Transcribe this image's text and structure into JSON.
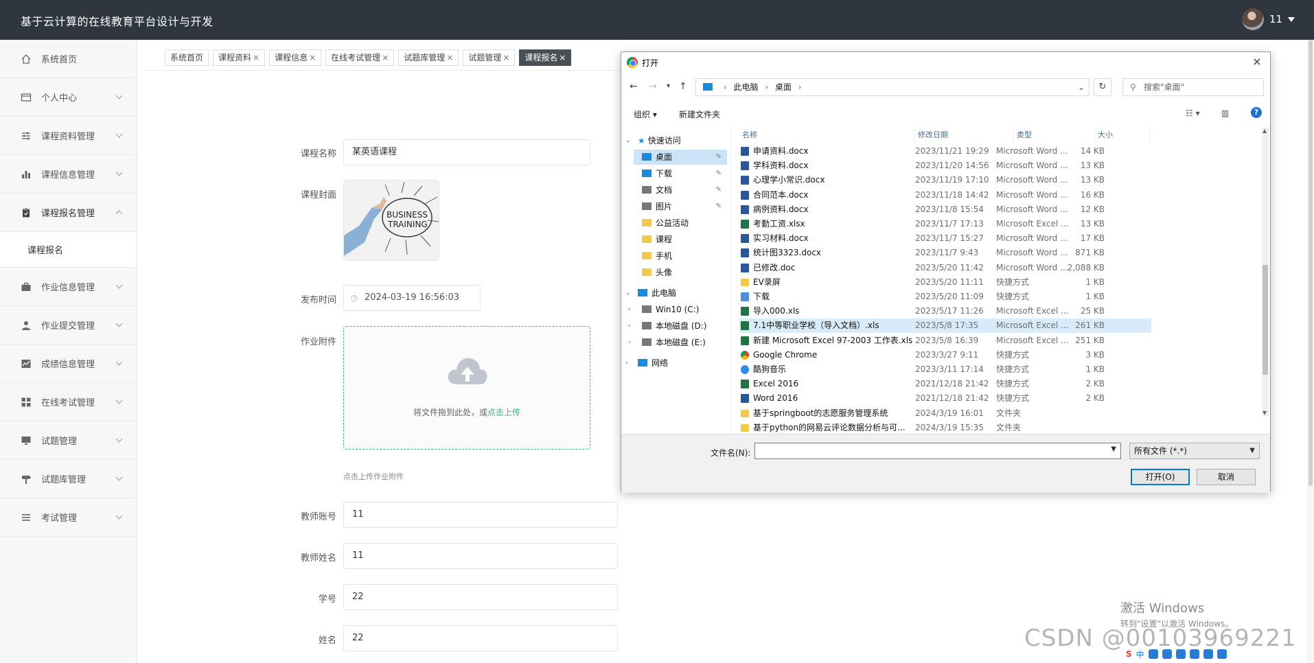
{
  "header": {
    "title": "基于云计算的在线教育平台设计与开发",
    "user": "11"
  },
  "sidebar": {
    "items": [
      {
        "label": "系统首页",
        "icon": "home-icon"
      },
      {
        "label": "个人中心",
        "icon": "id-card-icon"
      },
      {
        "label": "课程资料管理",
        "icon": "sliders-icon"
      },
      {
        "label": "课程信息管理",
        "icon": "bar-chart-icon"
      },
      {
        "label": "课程报名管理",
        "icon": "clipboard-icon",
        "open": true,
        "sub": [
          "课程报名"
        ]
      },
      {
        "label": "作业信息管理",
        "icon": "briefcase-icon"
      },
      {
        "label": "作业提交管理",
        "icon": "user-icon"
      },
      {
        "label": "成绩信息管理",
        "icon": "chart-line-icon"
      },
      {
        "label": "在线考试管理",
        "icon": "grid-icon"
      },
      {
        "label": "试题管理",
        "icon": "monitor-icon"
      },
      {
        "label": "试题库管理",
        "icon": "signpost-icon"
      },
      {
        "label": "考试管理",
        "icon": "list-icon"
      }
    ]
  },
  "tabs": [
    {
      "label": "系统首页",
      "closable": false
    },
    {
      "label": "课程资料",
      "closable": true
    },
    {
      "label": "课程信息",
      "closable": true
    },
    {
      "label": "在线考试管理",
      "closable": true
    },
    {
      "label": "试题库管理",
      "closable": true
    },
    {
      "label": "试题管理",
      "closable": true
    },
    {
      "label": "课程报名",
      "closable": true,
      "active": true
    }
  ],
  "tab_close": "×",
  "form": {
    "course_name_label": "课程名称",
    "course_name_value": "某英语课程",
    "cover_label": "课程封面",
    "cover_text_1": "BUSINESS",
    "cover_text_2": "TRAINING",
    "publish_time_label": "发布时间",
    "publish_time_value": "2024-03-19 16:56:03",
    "attachment_label": "作业附件",
    "upload_text": "将文件拖到此处，或",
    "upload_link": "点击上传",
    "upload_hint": "点击上传作业附件",
    "teacher_account_label": "教师账号",
    "teacher_account_value": "11",
    "teacher_name_label": "教师姓名",
    "teacher_name_value": "11",
    "student_id_label": "学号",
    "student_id_value": "22",
    "name_label": "姓名",
    "name_value": "22"
  },
  "dialog": {
    "title": "打开",
    "close": "×",
    "breadcrumb": [
      "此电脑",
      "桌面"
    ],
    "search_placeholder": "搜索\"桌面\"",
    "toolbar_organize": "组织 ▾",
    "toolbar_new_folder": "新建文件夹",
    "help": "?",
    "nav": [
      {
        "label": "快速访问",
        "level": 0,
        "kind": "star"
      },
      {
        "label": "桌面",
        "level": 1,
        "kind": "blue",
        "pinned": true,
        "selected": true
      },
      {
        "label": "下载",
        "level": 1,
        "kind": "blue",
        "pinned": true
      },
      {
        "label": "文档",
        "level": 1,
        "kind": "gray",
        "pinned": true
      },
      {
        "label": "图片",
        "level": 1,
        "kind": "gray",
        "pinned": true
      },
      {
        "label": "公益活动",
        "level": 1,
        "kind": "yellow"
      },
      {
        "label": "课程",
        "level": 1,
        "kind": "yellow"
      },
      {
        "label": "手机",
        "level": 1,
        "kind": "yellow"
      },
      {
        "label": "头像",
        "level": 1,
        "kind": "yellow"
      },
      {
        "label": "此电脑",
        "level": 0,
        "kind": "blue"
      },
      {
        "label": "Win10 (C:)",
        "level": 1,
        "kind": "gray"
      },
      {
        "label": "本地磁盘 (D:)",
        "level": 1,
        "kind": "gray"
      },
      {
        "label": "本地磁盘 (E:)",
        "level": 1,
        "kind": "gray"
      },
      {
        "label": "网络",
        "level": 0,
        "kind": "blue"
      }
    ],
    "columns": {
      "name": "名称",
      "date": "修改日期",
      "type": "类型",
      "size": "大小"
    },
    "files": [
      {
        "name": "申请资料.docx",
        "date": "2023/11/21 19:29",
        "type": "Microsoft Word ...",
        "size": "14 KB",
        "kind": "word"
      },
      {
        "name": "学科资料.docx",
        "date": "2023/11/20 14:56",
        "type": "Microsoft Word ...",
        "size": "13 KB",
        "kind": "word"
      },
      {
        "name": "心理学小常识.docx",
        "date": "2023/11/19 17:10",
        "type": "Microsoft Word ...",
        "size": "13 KB",
        "kind": "word"
      },
      {
        "name": "合同范本.docx",
        "date": "2023/11/18 14:42",
        "type": "Microsoft Word ...",
        "size": "16 KB",
        "kind": "word"
      },
      {
        "name": "病例资料.docx",
        "date": "2023/11/8 15:54",
        "type": "Microsoft Word ...",
        "size": "12 KB",
        "kind": "word"
      },
      {
        "name": "考勤工资.xlsx",
        "date": "2023/11/7 17:13",
        "type": "Microsoft Excel ...",
        "size": "13 KB",
        "kind": "excel"
      },
      {
        "name": "实习材料.docx",
        "date": "2023/11/7 15:27",
        "type": "Microsoft Word ...",
        "size": "17 KB",
        "kind": "word"
      },
      {
        "name": "统计图3323.docx",
        "date": "2023/11/7 9:43",
        "type": "Microsoft Word ...",
        "size": "871 KB",
        "kind": "word"
      },
      {
        "name": "已修改.doc",
        "date": "2023/5/20 11:42",
        "type": "Microsoft Word ...",
        "size": "2,088 KB",
        "kind": "word"
      },
      {
        "name": "EV录屏",
        "date": "2023/5/20 11:11",
        "type": "快捷方式",
        "size": "1 KB",
        "kind": "folder"
      },
      {
        "name": "下载",
        "date": "2023/5/20 11:09",
        "type": "快捷方式",
        "size": "1 KB",
        "kind": "lnk"
      },
      {
        "name": "导入000.xls",
        "date": "2023/5/17 11:26",
        "type": "Microsoft Excel ...",
        "size": "25 KB",
        "kind": "excel"
      },
      {
        "name": "7.1中等职业学校（导入文档）.xls",
        "date": "2023/5/8 17:35",
        "type": "Microsoft Excel ...",
        "size": "261 KB",
        "kind": "excel",
        "selected": true
      },
      {
        "name": "新建 Microsoft Excel 97-2003 工作表.xls",
        "date": "2023/5/8 16:39",
        "type": "Microsoft Excel ...",
        "size": "251 KB",
        "kind": "excel"
      },
      {
        "name": "Google Chrome",
        "date": "2023/3/27 9:11",
        "type": "快捷方式",
        "size": "3 KB",
        "kind": "chrome"
      },
      {
        "name": "酷狗音乐",
        "date": "2023/3/11 17:14",
        "type": "快捷方式",
        "size": "1 KB",
        "kind": "music"
      },
      {
        "name": "Excel 2016",
        "date": "2021/12/18 21:42",
        "type": "快捷方式",
        "size": "2 KB",
        "kind": "excel"
      },
      {
        "name": "Word 2016",
        "date": "2021/12/18 21:42",
        "type": "快捷方式",
        "size": "2 KB",
        "kind": "word"
      },
      {
        "name": "基于springboot的志愿服务管理系统",
        "date": "2024/3/19 16:01",
        "type": "文件夹",
        "size": "",
        "kind": "folder"
      },
      {
        "name": "基于python的网易云评论数据分析与可...",
        "date": "2024/3/19 15:35",
        "type": "文件夹",
        "size": "",
        "kind": "folder"
      }
    ],
    "filename_label": "文件名(N):",
    "filename_value": "",
    "filetype": "所有文件 (*.*)",
    "open_btn": "打开(O)",
    "cancel_btn": "取消"
  },
  "watermark": {
    "line1": "激活 Windows",
    "line2": "转到\"设置\"以激活 Windows。"
  },
  "csdn": "CSDN @00103969221",
  "tray": {
    "ime": "中"
  }
}
